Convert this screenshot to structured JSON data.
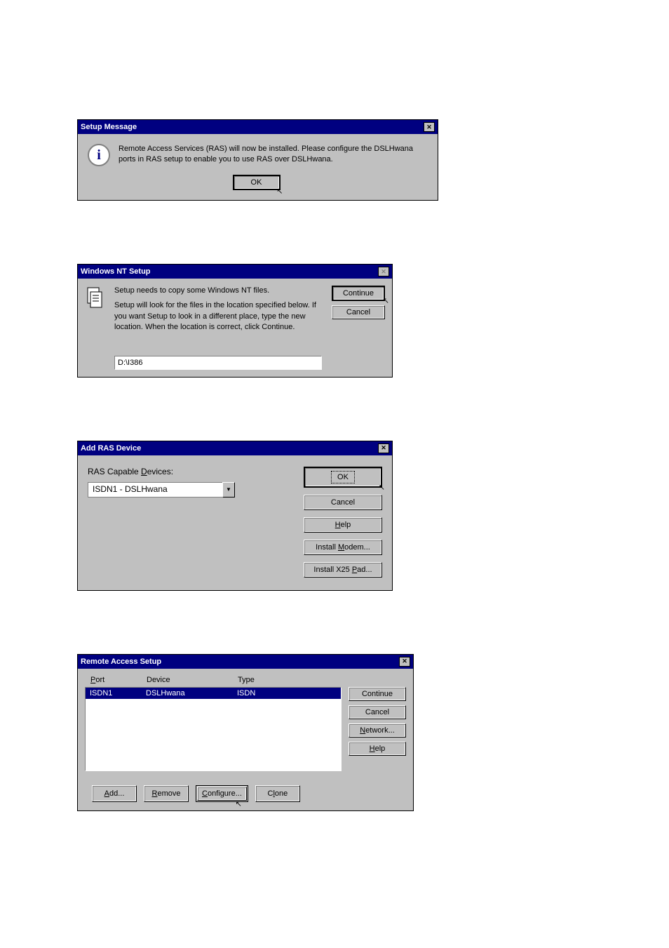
{
  "dlg1": {
    "title": "Setup Message",
    "message": "Remote Access Services (RAS) will now be installed. Please configure the DSLHwana ports in RAS setup to enable you to use RAS over DSLHwana.",
    "ok_label": "OK"
  },
  "dlg2": {
    "title": "Windows NT Setup",
    "msg1": "Setup needs to copy some Windows NT files.",
    "msg2": "Setup will look for the files in the location specified below. If you want Setup to look in a different place, type the new location. When the location is correct, click Continue.",
    "path_value": "D:\\I386",
    "continue_label": "Continue",
    "cancel_label": "Cancel"
  },
  "dlg3": {
    "title": "Add RAS Device",
    "devices_label_pre": "RAS Capable ",
    "devices_label_u": "D",
    "devices_label_post": "evices:",
    "selected_device": "ISDN1 - DSLHwana",
    "ok_label": "OK",
    "cancel_label": "Cancel",
    "help_pre": "",
    "help_u": "H",
    "help_post": "elp",
    "install_modem_pre": "Install ",
    "install_modem_u": "M",
    "install_modem_post": "odem...",
    "install_x25_pre": "Install X25 ",
    "install_x25_u": "P",
    "install_x25_post": "ad..."
  },
  "dlg4": {
    "title": "Remote Access Setup",
    "col_port_u": "P",
    "col_port_post": "ort",
    "col_device": "Device",
    "col_type": "Type",
    "row": {
      "port": "ISDN1",
      "device": "DSLHwana",
      "type": "ISDN"
    },
    "continue_label": "Continue",
    "cancel_label": "Cancel",
    "network_u": "N",
    "network_post": "etwork...",
    "help_u": "H",
    "help_post": "elp",
    "add_u": "A",
    "add_post": "dd...",
    "remove_u": "R",
    "remove_post": "emove",
    "configure_u": "C",
    "configure_post": "onfigure...",
    "clone_pre": "C",
    "clone_u": "l",
    "clone_post": "one"
  }
}
